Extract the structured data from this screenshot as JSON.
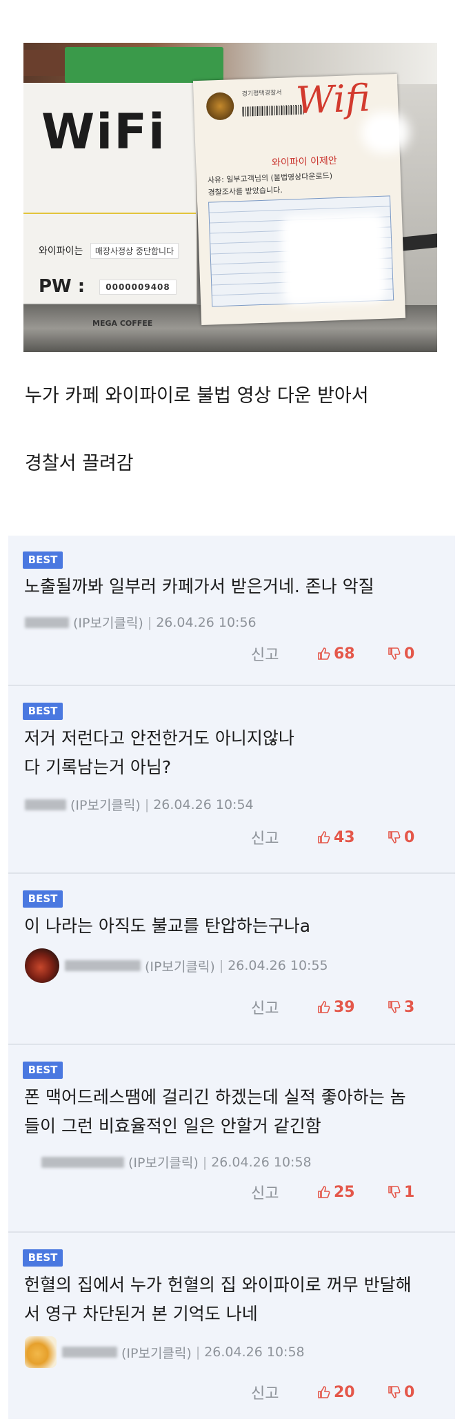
{
  "article": {
    "photo_text": {
      "wifi_sign": "WiFi",
      "ssid_label": "와이파이는",
      "ssid_value": "매장사정상 중단합니다",
      "pw_label": "PW :",
      "pw_value": "0000009408",
      "brand": "MEGA COFFEE",
      "paper_header": "경기평택경찰서",
      "paper_handwritten": "Wifi",
      "paper_red_note": "와이파이 이제안",
      "paper_line_1": "사유: 일부고객님의 (불법영상다운로드)",
      "paper_line_2": "경찰조사를 받았습니다."
    },
    "body_lines": [
      "누가 카페 와이파이로 불법 영상 다운 받아서",
      "경찰서 끌려감"
    ]
  },
  "comments": [
    {
      "badge": "BEST",
      "lines": [
        "노출될까봐 일부러 카페가서 받은거네.  존나 악질"
      ],
      "ip_label": "(IP보기클릭)",
      "date": "26.04.26 10:56",
      "report": "신고",
      "likes": "68",
      "dislikes": "0"
    },
    {
      "badge": "BEST",
      "lines": [
        "저거 저런다고 안전한거도 아니지않나",
        "다 기록남는거 아님?"
      ],
      "ip_label": "(IP보기클릭)",
      "date": "26.04.26 10:54",
      "report": "신고",
      "likes": "43",
      "dislikes": "0"
    },
    {
      "badge": "BEST",
      "lines": [
        "이 나라는 아직도 불교를 탄압하는구나a"
      ],
      "ip_label": "(IP보기클릭)",
      "date": "26.04.26 10:55",
      "report": "신고",
      "likes": "39",
      "dislikes": "3"
    },
    {
      "badge": "BEST",
      "lines": [
        "폰 맥어드레스땜에 걸리긴 하겠는데 실적 좋아하는 놈",
        "들이 그런 비효율적인 일은 안할거 같긴함"
      ],
      "ip_label": "(IP보기클릭)",
      "date": "26.04.26 10:58",
      "report": "신고",
      "likes": "25",
      "dislikes": "1"
    },
    {
      "badge": "BEST",
      "lines": [
        "헌혈의 집에서 누가 헌혈의 집 와이파이로 꺼무 반달해",
        "서 영구 차단된거 본 기억도 나네"
      ],
      "ip_label": "(IP보기클릭)",
      "date": "26.04.26 10:58",
      "report": "신고",
      "likes": "20",
      "dislikes": "0"
    }
  ],
  "colors": {
    "badge": "#4a78e0",
    "vote": "#e4574a",
    "comment_bg": "#f1f4fa",
    "meta_text": "#8e939a"
  },
  "icons": {
    "like": "thumbs-up-icon",
    "dislike": "thumbs-down-icon"
  }
}
